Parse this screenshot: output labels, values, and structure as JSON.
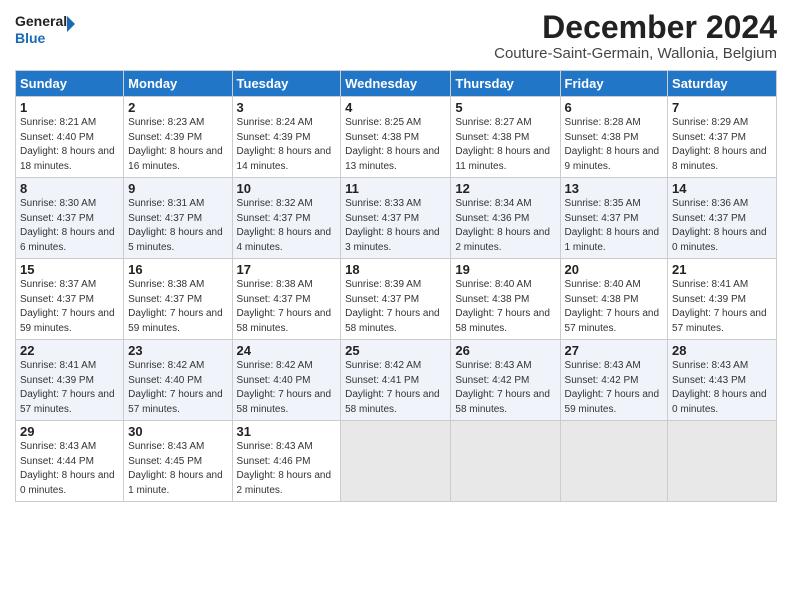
{
  "header": {
    "logo_line1": "General",
    "logo_line2": "Blue",
    "main_title": "December 2024",
    "subtitle": "Couture-Saint-Germain, Wallonia, Belgium"
  },
  "days_of_week": [
    "Sunday",
    "Monday",
    "Tuesday",
    "Wednesday",
    "Thursday",
    "Friday",
    "Saturday"
  ],
  "weeks": [
    [
      {
        "day": "1",
        "sunrise": "8:21 AM",
        "sunset": "4:40 PM",
        "daylight": "8 hours and 18 minutes."
      },
      {
        "day": "2",
        "sunrise": "8:23 AM",
        "sunset": "4:39 PM",
        "daylight": "8 hours and 16 minutes."
      },
      {
        "day": "3",
        "sunrise": "8:24 AM",
        "sunset": "4:39 PM",
        "daylight": "8 hours and 14 minutes."
      },
      {
        "day": "4",
        "sunrise": "8:25 AM",
        "sunset": "4:38 PM",
        "daylight": "8 hours and 13 minutes."
      },
      {
        "day": "5",
        "sunrise": "8:27 AM",
        "sunset": "4:38 PM",
        "daylight": "8 hours and 11 minutes."
      },
      {
        "day": "6",
        "sunrise": "8:28 AM",
        "sunset": "4:38 PM",
        "daylight": "8 hours and 9 minutes."
      },
      {
        "day": "7",
        "sunrise": "8:29 AM",
        "sunset": "4:37 PM",
        "daylight": "8 hours and 8 minutes."
      }
    ],
    [
      {
        "day": "8",
        "sunrise": "8:30 AM",
        "sunset": "4:37 PM",
        "daylight": "8 hours and 6 minutes."
      },
      {
        "day": "9",
        "sunrise": "8:31 AM",
        "sunset": "4:37 PM",
        "daylight": "8 hours and 5 minutes."
      },
      {
        "day": "10",
        "sunrise": "8:32 AM",
        "sunset": "4:37 PM",
        "daylight": "8 hours and 4 minutes."
      },
      {
        "day": "11",
        "sunrise": "8:33 AM",
        "sunset": "4:37 PM",
        "daylight": "8 hours and 3 minutes."
      },
      {
        "day": "12",
        "sunrise": "8:34 AM",
        "sunset": "4:36 PM",
        "daylight": "8 hours and 2 minutes."
      },
      {
        "day": "13",
        "sunrise": "8:35 AM",
        "sunset": "4:37 PM",
        "daylight": "8 hours and 1 minute."
      },
      {
        "day": "14",
        "sunrise": "8:36 AM",
        "sunset": "4:37 PM",
        "daylight": "8 hours and 0 minutes."
      }
    ],
    [
      {
        "day": "15",
        "sunrise": "8:37 AM",
        "sunset": "4:37 PM",
        "daylight": "7 hours and 59 minutes."
      },
      {
        "day": "16",
        "sunrise": "8:38 AM",
        "sunset": "4:37 PM",
        "daylight": "7 hours and 59 minutes."
      },
      {
        "day": "17",
        "sunrise": "8:38 AM",
        "sunset": "4:37 PM",
        "daylight": "7 hours and 58 minutes."
      },
      {
        "day": "18",
        "sunrise": "8:39 AM",
        "sunset": "4:37 PM",
        "daylight": "7 hours and 58 minutes."
      },
      {
        "day": "19",
        "sunrise": "8:40 AM",
        "sunset": "4:38 PM",
        "daylight": "7 hours and 58 minutes."
      },
      {
        "day": "20",
        "sunrise": "8:40 AM",
        "sunset": "4:38 PM",
        "daylight": "7 hours and 57 minutes."
      },
      {
        "day": "21",
        "sunrise": "8:41 AM",
        "sunset": "4:39 PM",
        "daylight": "7 hours and 57 minutes."
      }
    ],
    [
      {
        "day": "22",
        "sunrise": "8:41 AM",
        "sunset": "4:39 PM",
        "daylight": "7 hours and 57 minutes."
      },
      {
        "day": "23",
        "sunrise": "8:42 AM",
        "sunset": "4:40 PM",
        "daylight": "7 hours and 57 minutes."
      },
      {
        "day": "24",
        "sunrise": "8:42 AM",
        "sunset": "4:40 PM",
        "daylight": "7 hours and 58 minutes."
      },
      {
        "day": "25",
        "sunrise": "8:42 AM",
        "sunset": "4:41 PM",
        "daylight": "7 hours and 58 minutes."
      },
      {
        "day": "26",
        "sunrise": "8:43 AM",
        "sunset": "4:42 PM",
        "daylight": "7 hours and 58 minutes."
      },
      {
        "day": "27",
        "sunrise": "8:43 AM",
        "sunset": "4:42 PM",
        "daylight": "7 hours and 59 minutes."
      },
      {
        "day": "28",
        "sunrise": "8:43 AM",
        "sunset": "4:43 PM",
        "daylight": "8 hours and 0 minutes."
      }
    ],
    [
      {
        "day": "29",
        "sunrise": "8:43 AM",
        "sunset": "4:44 PM",
        "daylight": "8 hours and 0 minutes."
      },
      {
        "day": "30",
        "sunrise": "8:43 AM",
        "sunset": "4:45 PM",
        "daylight": "8 hours and 1 minute."
      },
      {
        "day": "31",
        "sunrise": "8:43 AM",
        "sunset": "4:46 PM",
        "daylight": "8 hours and 2 minutes."
      },
      null,
      null,
      null,
      null
    ]
  ],
  "labels": {
    "sunrise": "Sunrise:",
    "sunset": "Sunset:",
    "daylight": "Daylight:"
  }
}
